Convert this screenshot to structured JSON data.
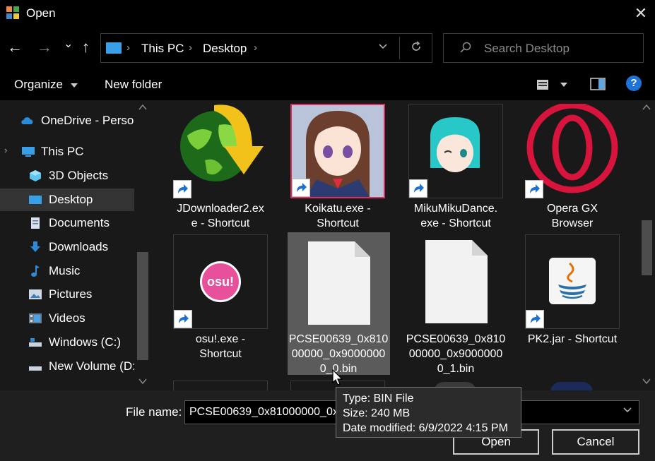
{
  "window": {
    "title": "Open",
    "close_glyph": "✕"
  },
  "nav": {
    "back_glyph": "←",
    "forward_glyph": "→",
    "recent_glyph": "⌄",
    "up_glyph": "↑",
    "breadcrumbs": [
      "This PC",
      "Desktop"
    ],
    "separator_glyph": "›",
    "search_placeholder": "Search Desktop"
  },
  "toolbar": {
    "organize_label": "Organize",
    "new_folder_label": "New folder",
    "help_glyph": "?"
  },
  "sidebar": {
    "items": [
      {
        "label": "OneDrive - Person",
        "icon": "cloud-icon"
      },
      {
        "label": "This PC",
        "icon": "computer-icon"
      },
      {
        "label": "3D Objects",
        "icon": "cube-icon"
      },
      {
        "label": "Desktop",
        "icon": "desktop-icon",
        "selected": true
      },
      {
        "label": "Documents",
        "icon": "document-icon"
      },
      {
        "label": "Downloads",
        "icon": "download-icon"
      },
      {
        "label": "Music",
        "icon": "music-icon"
      },
      {
        "label": "Pictures",
        "icon": "pictures-icon"
      },
      {
        "label": "Videos",
        "icon": "videos-icon"
      },
      {
        "label": "Windows (C:)",
        "icon": "drive-icon"
      },
      {
        "label": "New Volume (D:",
        "icon": "drive-icon"
      }
    ]
  },
  "files": [
    {
      "name": "JDownloader2.exe - Shortcut",
      "cap1": "JDownloader2.ex",
      "cap2": "e - Shortcut",
      "icon": "jdownloader-icon"
    },
    {
      "name": "Koikatu.exe - Shortcut",
      "cap1": "Koikatu.exe -",
      "cap2": "Shortcut",
      "icon": "koikatu-icon"
    },
    {
      "name": "MikuMikuDance.exe - Shortcut",
      "cap1": "MikuMikuDance.",
      "cap2": "exe - Shortcut",
      "icon": "miku-icon"
    },
    {
      "name": "Opera GX Browser",
      "cap1": "Opera GX",
      "cap2": "Browser",
      "icon": "opera-gx-icon"
    },
    {
      "name": "osu!.exe - Shortcut",
      "cap1": "osu!.exe -",
      "cap2": "Shortcut",
      "icon": "osu-icon",
      "icon_text": "osu!"
    },
    {
      "name": "PCSE00639_0x81000000_0x90000000_0.bin",
      "cap1": "PCSE00639_0x810",
      "cap2": "00000_0x9000000",
      "cap3": "0_0.bin",
      "icon": "blank-file-icon",
      "hovered": true
    },
    {
      "name": "PCSE00639_0x81000000_0x90000000_1.bin",
      "cap1": "PCSE00639_0x810",
      "cap2": "00000_0x9000000",
      "cap3": "0_1.bin",
      "icon": "blank-file-icon"
    },
    {
      "name": "PK2.jar - Shortcut",
      "cap1": "PK2.jar - Shortcut",
      "icon": "java-icon"
    }
  ],
  "tooltip": {
    "type": "Type: BIN File",
    "size": "Size: 240 MB",
    "modified": "Date modified: 6/9/2022 4:15 PM"
  },
  "footer": {
    "file_name_label": "File name:",
    "file_name_value": "PCSE00639_0x81000000_0x90000000_0.bin",
    "open_label": "Open",
    "cancel_label": "Cancel"
  },
  "colors": {
    "accent": "#39a0e8",
    "selection": "#333333",
    "hover_tile": "#5b5b5b",
    "osu_pink": "#e8509c",
    "opera_red": "#d7143c"
  }
}
